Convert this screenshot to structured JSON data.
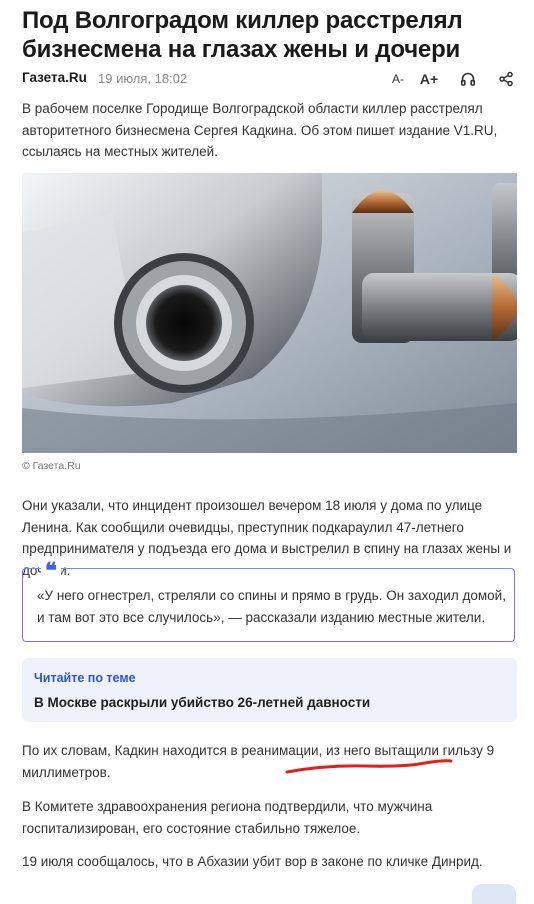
{
  "article": {
    "title": "Под Волгоградом киллер расстрелял бизнесмена на глазах жены и дочери",
    "source": "Газета.Ru",
    "date": "19 июля, 18:02",
    "font_decrease": "A-",
    "font_increase": "A+",
    "paragraph1": "В рабочем поселке Городище Волгоградской области киллер расстрелял авторитетного бизнесмена Сергея Кадкина. Об этом пишет издание V1.RU, ссылаясь на местных жителей.",
    "image_caption": "© Газета.Ru",
    "paragraph2": "Они указали, что инцидент произошел вечером 18 июля у дома по улице Ленина. Как сообщили очевидцы, преступник подкараулил 47-летнего предпринимателя у подъезда его дома и выстрелил в спину на глазах жены и дочери.",
    "quote": "«У него огнестрел, стреляли со спины и прямо в грудь. Он заходил домой, и там вот это все случилось», — рассказали изданию местные жители.",
    "quote_mark": "❝",
    "paragraph3": "По их словам, Кадкин находится в реанимации, из него вытащили гильзу 9 миллиметров.",
    "paragraph4": "В Комитете здравоохранения региона подтвердили, что мужчина госпитализирован, его состояние стабильно тяжелое.",
    "paragraph5": "19 июля сообщалось, что в Абхазии убит вор в законе по кличке Динрид."
  },
  "related": {
    "label": "Читайте по теме",
    "link": "В Москве раскрыли убийство 26-летней давности"
  },
  "icons": {
    "audio": "headphones-icon",
    "share": "share-icon",
    "quote": "quote-icon"
  },
  "colors": {
    "accent": "#2c55d6",
    "quote_border": "#8e6ad8",
    "underline": "#e0201b",
    "related_bg": "#eef2fa"
  }
}
